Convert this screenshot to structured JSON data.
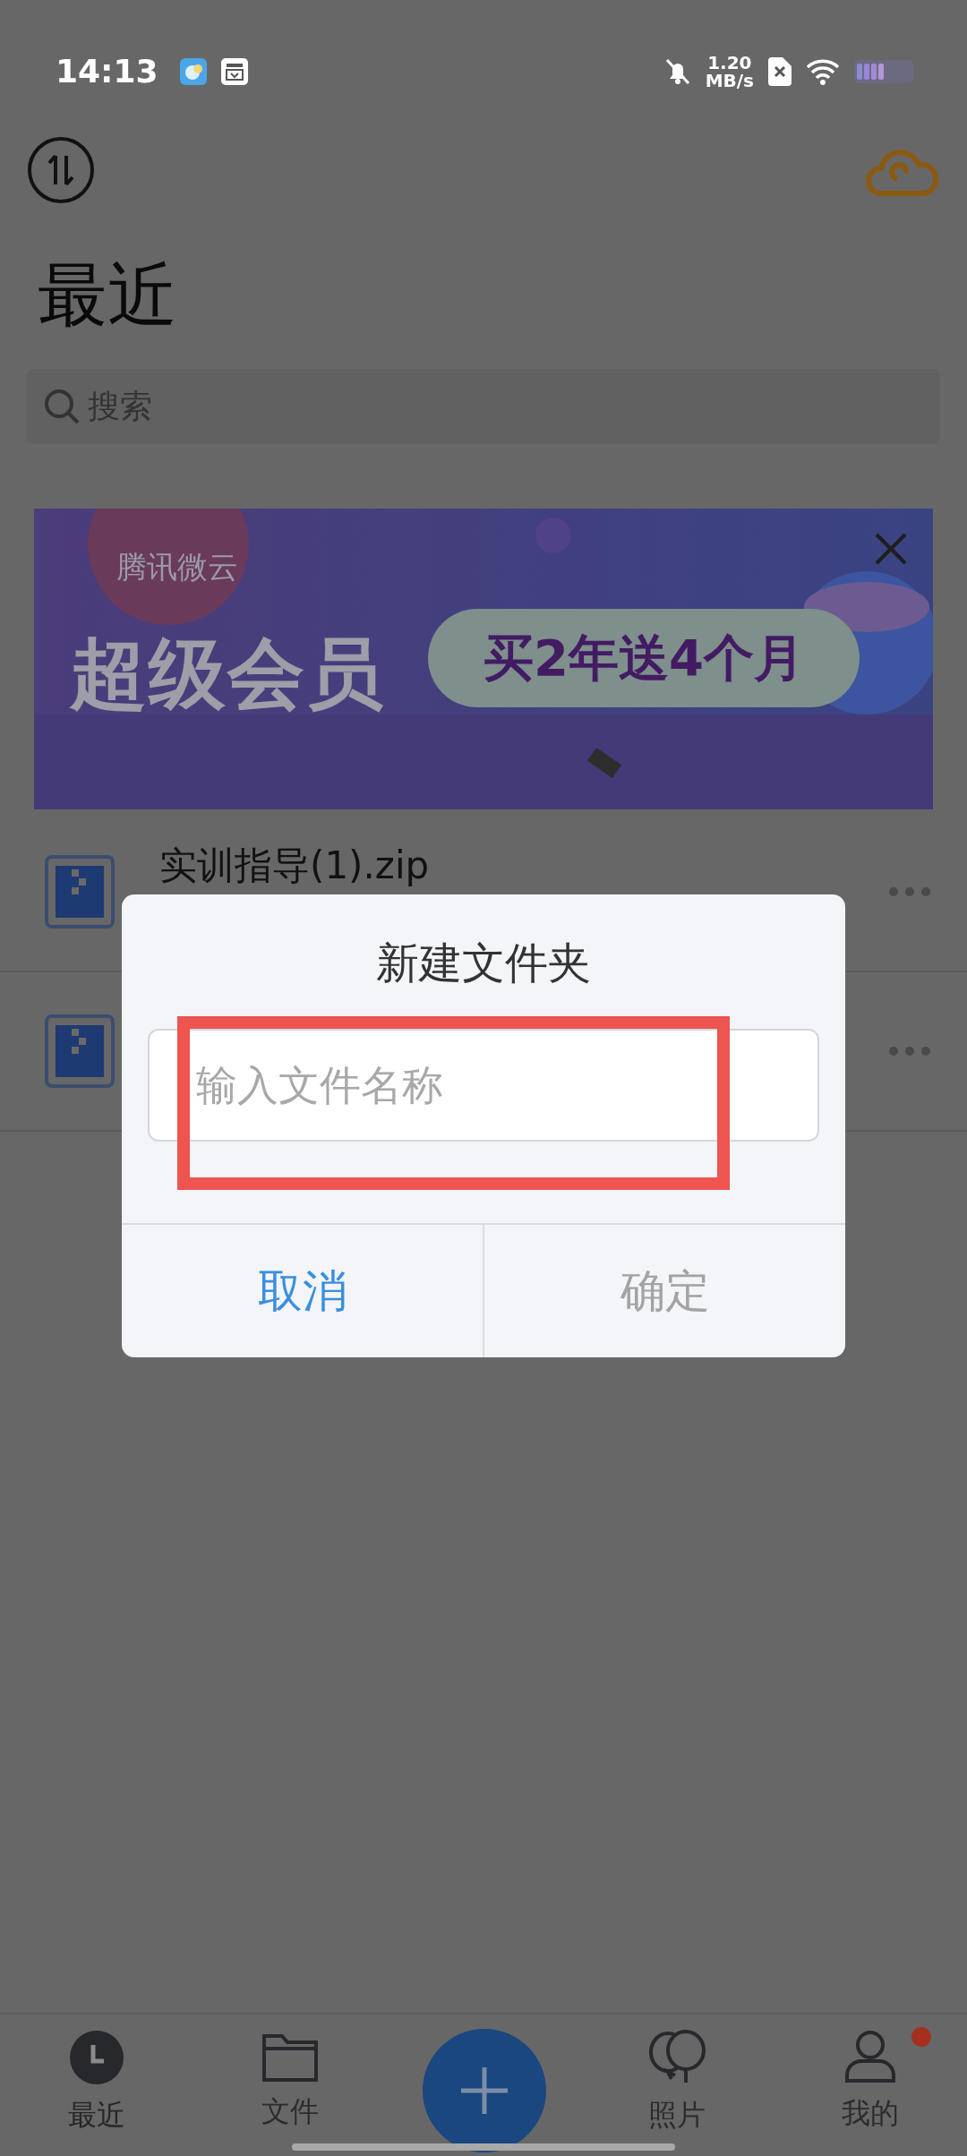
{
  "status_bar": {
    "time": "14:13",
    "net_speed": "1.20",
    "net_unit": "MB/s"
  },
  "header": {
    "title": "最近"
  },
  "search": {
    "placeholder": "搜索"
  },
  "banner": {
    "brand": "腾讯微云",
    "headline": "超级会员",
    "offer": "买2年送4个月"
  },
  "files": [
    {
      "kind": "zip",
      "name": "实训指导(1).zip"
    },
    {
      "kind": "zip"
    }
  ],
  "dialog": {
    "title": "新建文件夹",
    "input": {
      "placeholder": "输入文件名称"
    },
    "buttons": [
      {
        "kind": "cancel",
        "label": "取消",
        "disabled": false
      },
      {
        "kind": "confirm",
        "label": "确定",
        "disabled": true
      }
    ]
  },
  "tabs": [
    {
      "label": "最近",
      "selected": true,
      "badge": false
    },
    {
      "label": "文件",
      "selected": false,
      "badge": false
    },
    {
      "label": "照片",
      "selected": false,
      "badge": false
    },
    {
      "label": "我的",
      "selected": false,
      "badge": true
    }
  ]
}
